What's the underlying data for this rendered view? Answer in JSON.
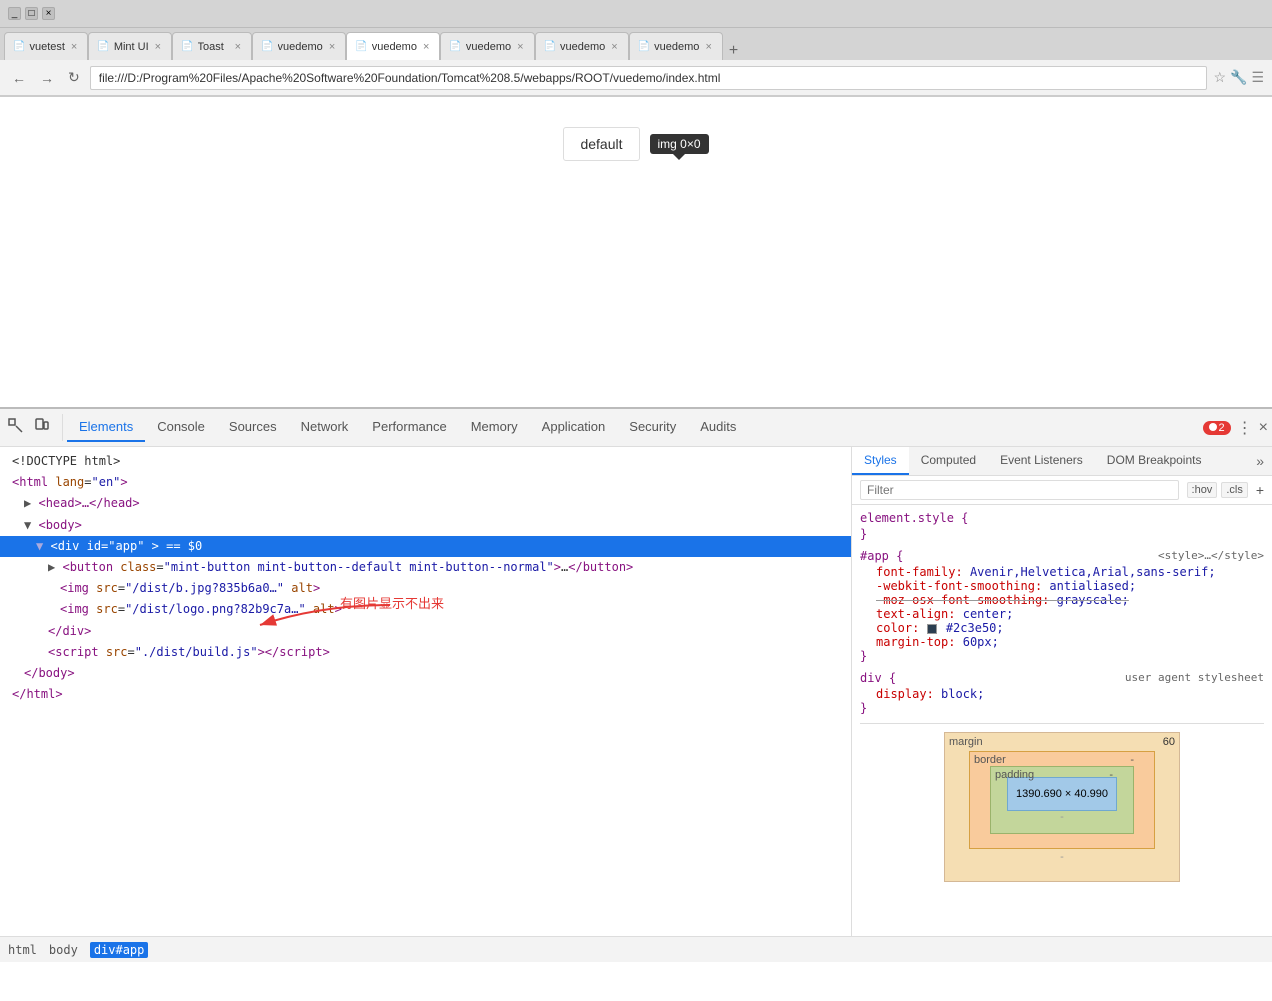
{
  "browser": {
    "title": "Browser",
    "tabs": [
      {
        "id": "vuetest",
        "label": "vuetest",
        "icon": "📄",
        "active": false
      },
      {
        "id": "mintui",
        "label": "Mint UI",
        "icon": "📄",
        "active": false
      },
      {
        "id": "toast",
        "label": "Toast",
        "icon": "📄",
        "active": false
      },
      {
        "id": "vuedemo1",
        "label": "vuedemo",
        "icon": "📄",
        "active": false
      },
      {
        "id": "vuedemo2",
        "label": "vuedemo",
        "icon": "📄",
        "active": true
      },
      {
        "id": "vuedemo3",
        "label": "vuedemo",
        "icon": "📄",
        "active": false
      },
      {
        "id": "vuedemo4",
        "label": "vuedemo",
        "icon": "📄",
        "active": false
      },
      {
        "id": "vuedemo5",
        "label": "vuedemo",
        "icon": "📄",
        "active": false
      }
    ],
    "address": "file:///D:/Program%20Files/Apache%20Software%20Foundation/Tomcat%208.5/webapps/ROOT/vuedemo/index.html"
  },
  "page": {
    "button_label": "default",
    "img_tooltip": "img  0×0"
  },
  "devtools": {
    "tabs": [
      {
        "id": "elements",
        "label": "Elements",
        "active": true
      },
      {
        "id": "console",
        "label": "Console",
        "active": false
      },
      {
        "id": "sources",
        "label": "Sources",
        "active": false
      },
      {
        "id": "network",
        "label": "Network",
        "active": false
      },
      {
        "id": "performance",
        "label": "Performance",
        "active": false
      },
      {
        "id": "memory",
        "label": "Memory",
        "active": false
      },
      {
        "id": "application",
        "label": "Application",
        "active": false
      },
      {
        "id": "security",
        "label": "Security",
        "active": false
      },
      {
        "id": "audits",
        "label": "Audits",
        "active": false
      }
    ],
    "error_count": "2",
    "html_lines": [
      {
        "id": "doctype",
        "text": "<!DOCTYPE html>",
        "indent": 0,
        "selected": false
      },
      {
        "id": "html",
        "text": "<html lang=\"en\">",
        "indent": 0,
        "selected": false
      },
      {
        "id": "head",
        "text": "▶ <head>…</head>",
        "indent": 1,
        "selected": false
      },
      {
        "id": "body",
        "text": "▼ <body>",
        "indent": 1,
        "selected": false
      },
      {
        "id": "div-app",
        "text": "▼ <div id=\"app\"> == $0",
        "indent": 2,
        "selected": true
      },
      {
        "id": "button",
        "text": "▶ <button class=\"mint-button mint-button--default mint-button--normal\">…</button>",
        "indent": 3,
        "selected": false
      },
      {
        "id": "img1",
        "text": "<img src=\"/dist/b.jpg?835b6a0…\" alt>",
        "indent": 4,
        "selected": false
      },
      {
        "id": "img2",
        "text": "<img src=\"/dist/logo.png?82b9c7a…\" alt>",
        "indent": 4,
        "selected": false
      },
      {
        "id": "div-close",
        "text": "</div>",
        "indent": 3,
        "selected": false
      },
      {
        "id": "script",
        "text": "<script src=\"./dist/build.js\"></script>",
        "indent": 3,
        "selected": false
      },
      {
        "id": "body-close",
        "text": "</body>",
        "indent": 1,
        "selected": false
      },
      {
        "id": "html-close",
        "text": "</html>",
        "indent": 0,
        "selected": false
      }
    ],
    "annotation_text": "有图片显示不出来",
    "styles": {
      "tabs": [
        "Styles",
        "Computed",
        "Event Listeners",
        "DOM Breakpoints"
      ],
      "active_tab": "Styles",
      "filter_placeholder": "Filter",
      "filter_hov": ":hov",
      "filter_cls": ".cls",
      "rules": [
        {
          "selector": "element.style {",
          "close": "}",
          "props": []
        },
        {
          "selector": "#app {",
          "source": "<style>…</style>",
          "close": "}",
          "props": [
            {
              "name": "font-family:",
              "value": "Avenir,Helvetica,Arial,sans-serif;",
              "strikethrough": false
            },
            {
              "name": "-webkit-font-smoothing:",
              "value": "antialiased;",
              "strikethrough": false
            },
            {
              "name": "-moz-osx-font-smoothing:",
              "value": "grayscale;",
              "strikethrough": true
            },
            {
              "name": "text-align:",
              "value": "center;",
              "strikethrough": false
            },
            {
              "name": "color:",
              "value": "#2c3e50;",
              "strikethrough": false
            },
            {
              "name": "margin-top:",
              "value": "60px;",
              "strikethrough": false
            }
          ]
        },
        {
          "selector": "div {",
          "source": "user agent stylesheet",
          "close": "}",
          "props": [
            {
              "name": "display:",
              "value": "block;",
              "strikethrough": false
            }
          ]
        }
      ]
    },
    "box_model": {
      "margin_label": "margin",
      "margin_val": "60",
      "border_label": "border",
      "border_val": "-",
      "padding_label": "padding",
      "padding_val": "-",
      "content_size": "1390.690 × 40.990",
      "dash1": "-",
      "dash2": "-"
    }
  },
  "breadcrumb": {
    "items": [
      {
        "id": "html",
        "label": "html",
        "selected": false
      },
      {
        "id": "body",
        "label": "body",
        "selected": false
      },
      {
        "id": "div-app",
        "label": "div#app",
        "selected": true
      }
    ]
  }
}
